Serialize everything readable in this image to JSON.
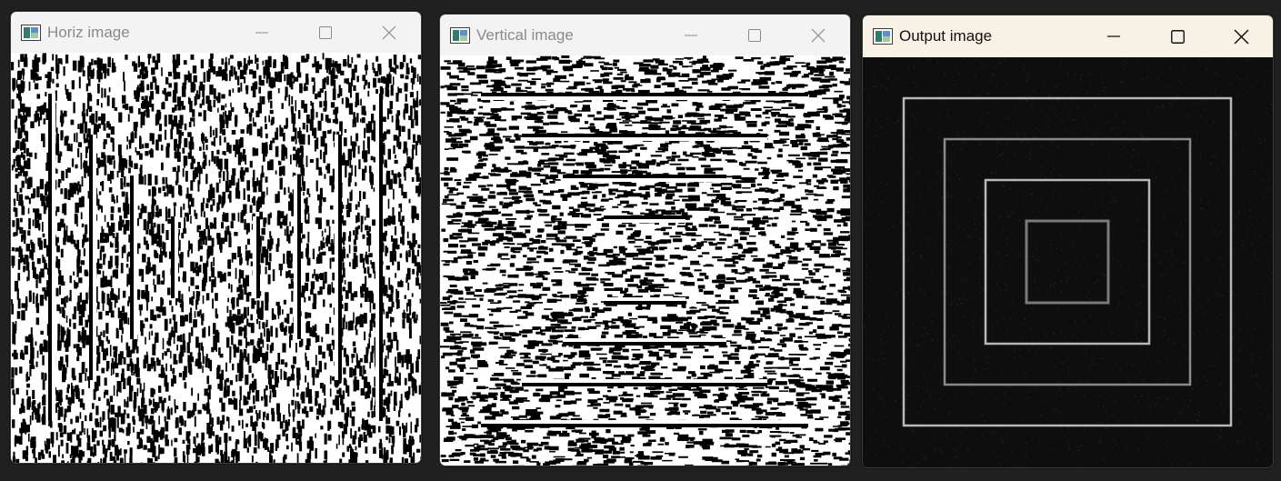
{
  "windows": [
    {
      "id": "horiz",
      "title": "Horiz image",
      "state": "inactive",
      "controls": {
        "minimize": "minimize-icon",
        "maximize": "maximize-icon",
        "close": "close-icon"
      },
      "content": "binary edge map with vertical white/black line pairs over noise"
    },
    {
      "id": "vertical",
      "title": "Vertical image",
      "state": "inactive",
      "controls": {
        "minimize": "minimize-icon",
        "maximize": "maximize-icon",
        "close": "close-icon"
      },
      "content": "binary edge map with horizontal white/black line pairs over noise"
    },
    {
      "id": "output",
      "title": "Output image",
      "state": "active",
      "controls": {
        "minimize": "minimize-icon",
        "maximize": "maximize-icon",
        "close": "close-icon"
      },
      "content": "dark image with four concentric light-gray square outlines"
    }
  ],
  "colors": {
    "desktop": "#202020",
    "titlebar_inactive": "#f3f3f3",
    "titlebar_active": "#f8f1e6",
    "title_inactive": "#8a8a8a",
    "title_active": "#111111",
    "output_background": "#0e0e0e",
    "output_lines": "#b8b8b8"
  }
}
